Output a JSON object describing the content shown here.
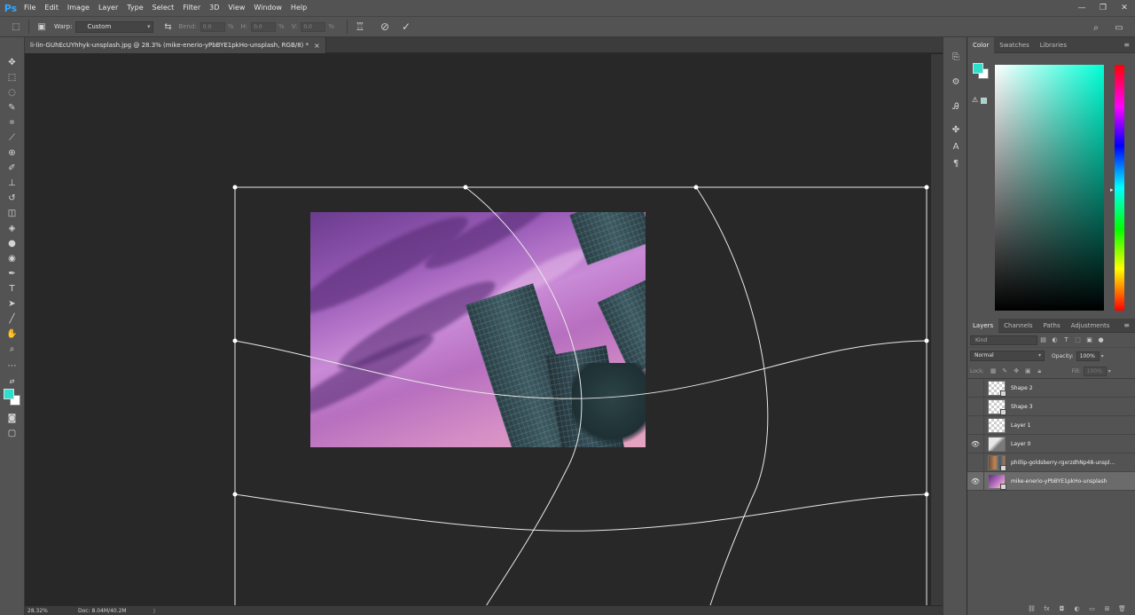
{
  "app": {
    "logo": "Ps"
  },
  "menu": [
    "File",
    "Edit",
    "Image",
    "Layer",
    "Type",
    "Select",
    "Filter",
    "3D",
    "View",
    "Window",
    "Help"
  ],
  "window_controls": [
    "—",
    "❐",
    "✕"
  ],
  "options": {
    "warp_label": "Warp:",
    "warp_value": "Custom",
    "bend_label": "Bend:",
    "bend_value": "0.0",
    "h_label": "H:",
    "h_value": "0.0",
    "v_label": "V:",
    "v_value": "0.0",
    "pct": "%",
    "cancel_icon": "⃠",
    "commit_icon": "✓"
  },
  "document": {
    "tab_title": "li-lin-GUhEcUYhhyk-unsplash.jpg @ 28.3% (mike-enerio-yPbBYE1pkHo-unsplash, RGB/8) *",
    "close": "×"
  },
  "status": {
    "zoom": "28.32%",
    "doc": "Doc: 8.04M/40.2M",
    "arrow": "〉"
  },
  "color_panel": {
    "tabs": [
      "Color",
      "Swatches",
      "Libraries"
    ],
    "fg_color": "#2de0cc",
    "bg_color": "#ffffff"
  },
  "layers_panel": {
    "tabs": [
      "Layers",
      "Channels",
      "Paths",
      "Adjustments"
    ],
    "kind_placeholder": "Kind",
    "blend_mode": "Normal",
    "opacity_label": "Opacity:",
    "opacity_value": "100%",
    "lock_label": "Lock:",
    "fill_label": "Fill:",
    "fill_value": "100%",
    "layers": [
      {
        "name": "Shape 2",
        "visible": false,
        "thumb": "checker",
        "smart": true
      },
      {
        "name": "Shape 3",
        "visible": false,
        "thumb": "checker",
        "smart": true
      },
      {
        "name": "Layer 1",
        "visible": false,
        "thumb": "checker",
        "smart": false
      },
      {
        "name": "Layer 0",
        "visible": true,
        "thumb": "tree",
        "smart": false
      },
      {
        "name": "phillip-goldsberry-rgxrzdhNp48-unspl...",
        "visible": false,
        "thumb": "phillip",
        "smart": true
      },
      {
        "name": "mike-enerio-yPbBYE1pkHo-unsplash",
        "visible": true,
        "thumb": "mike",
        "smart": true,
        "selected": true
      }
    ]
  }
}
